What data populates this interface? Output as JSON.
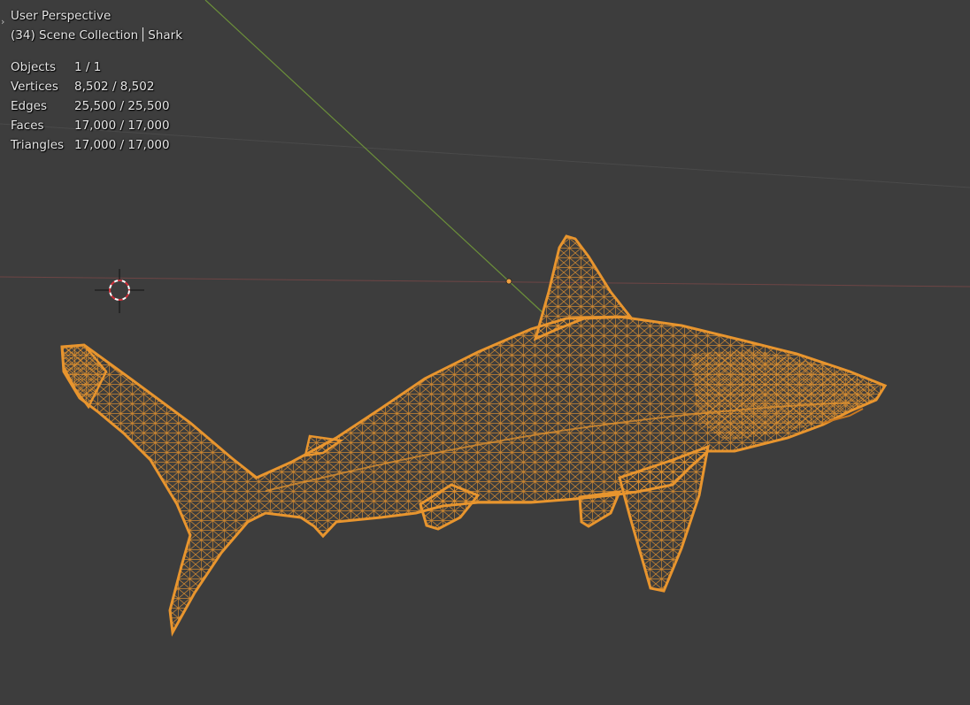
{
  "viewport": {
    "view_name": "User Perspective",
    "frame": "(34)",
    "collection": "Scene Collection",
    "object": "Shark"
  },
  "stats": [
    {
      "label": "Objects",
      "value": "1 / 1"
    },
    {
      "label": "Vertices",
      "value": "8,502 / 8,502"
    },
    {
      "label": "Edges",
      "value": "25,500 / 25,500"
    },
    {
      "label": "Faces",
      "value": "17,000 / 17,000"
    },
    {
      "label": "Triangles",
      "value": "17,000 / 17,000"
    }
  ],
  "colors": {
    "background": "#3d3d3d",
    "selection": "#e8952e",
    "x_axis": "#8a4b4b",
    "y_axis": "#6b8f3a",
    "text": "#e6e6e6"
  },
  "icons": {
    "expand": "chevron-right-icon",
    "cursor": "3d-cursor-icon",
    "origin": "object-origin-icon"
  }
}
